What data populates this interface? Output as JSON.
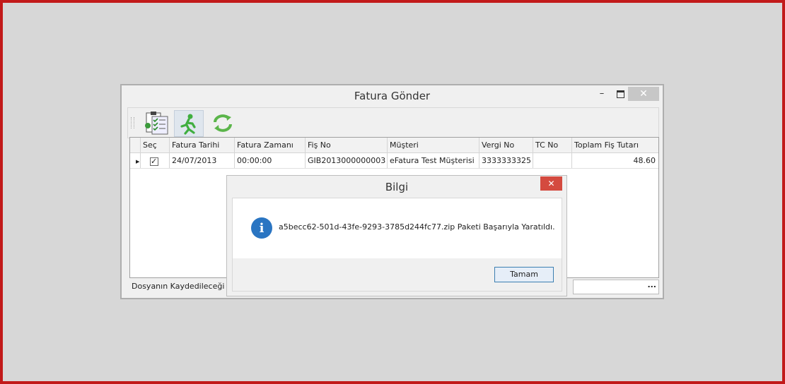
{
  "window": {
    "title": "Fatura Gönder",
    "min_symbol": "–",
    "close_symbol": "✕"
  },
  "toolbar": {
    "buttons": [
      {
        "icon": "document-checklist-icon"
      },
      {
        "icon": "running-man-icon"
      },
      {
        "icon": "refresh-icon"
      }
    ]
  },
  "grid": {
    "columns": [
      "Seç",
      "Fatura Tarihi",
      "Fatura Zamanı",
      "Fiş No",
      "Müşteri",
      "Vergi No",
      "TC No",
      "Toplam Fiş Tutarı"
    ],
    "rows": [
      {
        "selected": true,
        "fatura_tarihi": "24/07/2013",
        "fatura_zamani": "00:00:00",
        "fis_no": "GIB2013000000003",
        "musteri": "eFatura Test Müşterisi",
        "vergi_no": "3333333325",
        "tc_no": "",
        "toplam": "48.60"
      }
    ]
  },
  "path": {
    "label": "Dosyanın Kaydedileceği Yol",
    "button": "..."
  },
  "dialog": {
    "title": "Bilgi",
    "close_symbol": "✕",
    "icon": "i",
    "message": "a5becc62-501d-43fe-9293-3785d244fc77.zip Paketi Başarıyla Yaratıldı.",
    "ok_label": "Tamam"
  },
  "colors": {
    "border_red": "#c21a1a",
    "info_blue": "#2a75c2",
    "close_red": "#d44a3f"
  }
}
